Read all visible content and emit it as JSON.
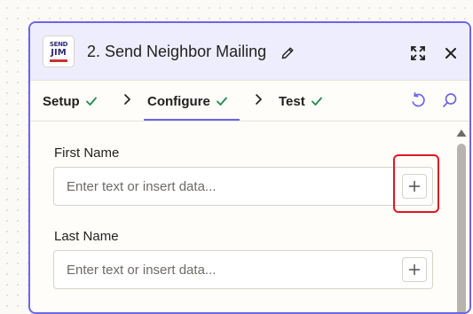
{
  "header": {
    "app_logo": {
      "line1": "SEND",
      "line2": "JIM",
      "brand_color": "#2e2b7a"
    },
    "step_title": "2. Send Neighbor Mailing",
    "accent_color": "#6b66e8"
  },
  "tabs": [
    {
      "label": "Setup",
      "complete": true
    },
    {
      "label": "Configure",
      "complete": true,
      "active": true
    },
    {
      "label": "Test",
      "complete": true
    }
  ],
  "fields": [
    {
      "label": "First Name",
      "placeholder": "Enter text or insert data...",
      "value": ""
    },
    {
      "label": "Last Name",
      "placeholder": "Enter text or insert data...",
      "value": ""
    }
  ],
  "colors": {
    "check": "#1f8a4c",
    "highlight": "#e0161c"
  }
}
